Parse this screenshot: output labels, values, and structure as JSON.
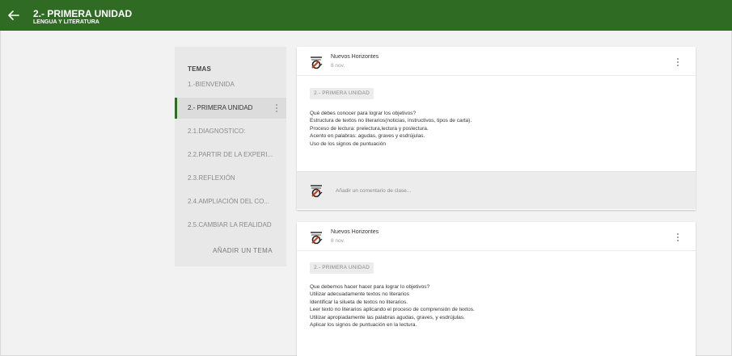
{
  "header": {
    "back_icon": "arrow-left-icon",
    "title": "2.- PRIMERA UNIDAD",
    "subtitle": "LENGUA Y LITERATURA",
    "bg_color": "#2f6b23"
  },
  "sidebar": {
    "heading": "TEMAS",
    "items": [
      {
        "label": "1.-BIENVENIDA",
        "active": false
      },
      {
        "label": "2.- PRIMERA UNIDAD",
        "active": true
      },
      {
        "label": "2.1.DIAGNOSTICO:",
        "active": false
      },
      {
        "label": "2.2.PARTIR DE LA EXPERI...",
        "active": false
      },
      {
        "label": "2.3.REFLEXIÓN",
        "active": false
      },
      {
        "label": "2.4.AMPLIACIÓN DEL CO...",
        "active": false
      },
      {
        "label": "2.5.CAMBIAR LA REALIDAD",
        "active": false
      }
    ],
    "add_topic": "AÑADIR UN TEMA"
  },
  "posts": [
    {
      "author": "Nuevos Horizontes",
      "date": "8 nov.",
      "chip": "2.- PRIMERA UNIDAD",
      "lines": [
        "Qué debes conocer para lograr los objetivos?",
        "Estructura de textos no literarios(noticias, instructivos, tipos de carta).",
        "Proceso de lectura: prelectura,lectura y poslectura.",
        "Acento en palabras: agudas, graves y esdrújulas.",
        "Uso de los signos de puntuación"
      ],
      "comment_placeholder": "Añadir un comentario de clase..."
    },
    {
      "author": "Nuevos Horizontes",
      "date": "8 nov.",
      "chip": "2.- PRIMERA UNIDAD",
      "lines": [
        "Que debemos hacer hacer para lograr lo objetivos?",
        "Utilizar adecuadamente textos no literarios",
        "Identificar la silueta de textos no literarios.",
        "Leer texto no literarios aplicando el proceso de comprensión de textos.",
        "Utilizar apropiadamente las palabras agudas, graves, y esdrújulas.",
        "Aplicar los signos de puntuación en la lectura."
      ]
    }
  ]
}
